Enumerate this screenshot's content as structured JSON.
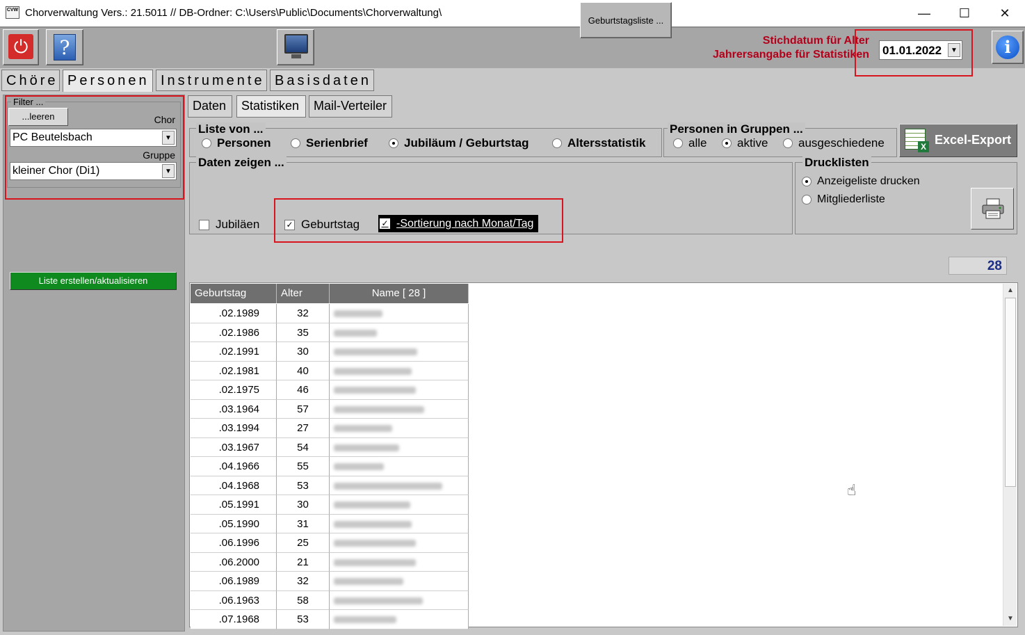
{
  "window": {
    "title": "Chorverwaltung Vers.: 21.5011 // DB-Ordner: C:\\Users\\Public\\Documents\\Chorverwaltung\\",
    "app_icon_text": "CVW",
    "minimize": "—",
    "maximize": "☐",
    "close": "✕"
  },
  "toolbar": {
    "power_glyph": "⏻",
    "help_glyph": "?",
    "geburtstagsliste_label": "Geburtstagsliste ...",
    "stichdatum_line1": "Stichdatum für Alter",
    "stichdatum_line2": "Jahrersangabe für Statistiken",
    "date_value": "01.01.2022",
    "info_glyph": "i"
  },
  "main_tabs": [
    {
      "label": "Chöre",
      "active": false
    },
    {
      "label": "Personen",
      "active": true
    },
    {
      "label": "Instrumente",
      "active": false
    },
    {
      "label": "Basisdaten",
      "active": false
    }
  ],
  "filter": {
    "legend": "Filter ...",
    "leeren_label": "...leeren",
    "chor_label": "Chor",
    "chor_value": "PC Beutelsbach",
    "gruppe_label": "Gruppe",
    "gruppe_value": "kleiner Chor (Di1)",
    "liste_button": "Liste erstellen/aktualisieren"
  },
  "sub_tabs": [
    {
      "label": "Daten",
      "active": false
    },
    {
      "label": "Statistiken",
      "active": true
    },
    {
      "label": "Mail-Verteiler",
      "active": false
    }
  ],
  "liste_von": {
    "legend": "Liste von ...",
    "options": [
      "Personen",
      "Serienbrief",
      "Jubiläum / Geburtstag",
      "Altersstatistik"
    ],
    "selected": "Jubiläum / Geburtstag"
  },
  "personen_in_gruppen": {
    "legend": "Personen in Gruppen ...",
    "options": [
      "alle",
      "aktive",
      "ausgeschiedene"
    ],
    "selected": "aktive"
  },
  "excel_export": {
    "label": "Excel-Export",
    "icon_x": "X"
  },
  "daten_zeigen": {
    "legend": "Daten zeigen ...",
    "jubilaeen": "Jubiläen",
    "geburtstag": "Geburtstag",
    "sortierung": "-Sortierung nach Monat/Tag",
    "check_mark": "✓"
  },
  "drucklisten": {
    "legend": "Drucklisten",
    "options": [
      "Anzeigeliste drucken",
      "Mitgliederliste"
    ],
    "selected": "Anzeigeliste drucken"
  },
  "count": "28",
  "grid": {
    "headers": [
      "Geburtstag",
      "Alter",
      "Name  [ 28 ]"
    ],
    "rows": [
      {
        "date": ".02.1989",
        "age": "32"
      },
      {
        "date": ".02.1986",
        "age": "35"
      },
      {
        "date": ".02.1991",
        "age": "30"
      },
      {
        "date": ".02.1981",
        "age": "40"
      },
      {
        "date": ".02.1975",
        "age": "46"
      },
      {
        "date": ".03.1964",
        "age": "57"
      },
      {
        "date": ".03.1994",
        "age": "27"
      },
      {
        "date": ".03.1967",
        "age": "54"
      },
      {
        "date": ".04.1966",
        "age": "55"
      },
      {
        "date": ".04.1968",
        "age": "53"
      },
      {
        "date": ".05.1991",
        "age": "30"
      },
      {
        "date": ".05.1990",
        "age": "31"
      },
      {
        "date": ".06.1996",
        "age": "25"
      },
      {
        "date": ".06.2000",
        "age": "21"
      },
      {
        "date": ".06.1989",
        "age": "32"
      },
      {
        "date": ".06.1963",
        "age": "58"
      },
      {
        "date": ".07.1968",
        "age": "53"
      }
    ],
    "scroll_up": "▲",
    "scroll_down": "▼"
  },
  "cursor_glyph": "☝",
  "colors": {
    "accent_red": "#b3001b",
    "liste_button_green": "#0f8a1f",
    "count_blue": "#1a2e8a"
  }
}
